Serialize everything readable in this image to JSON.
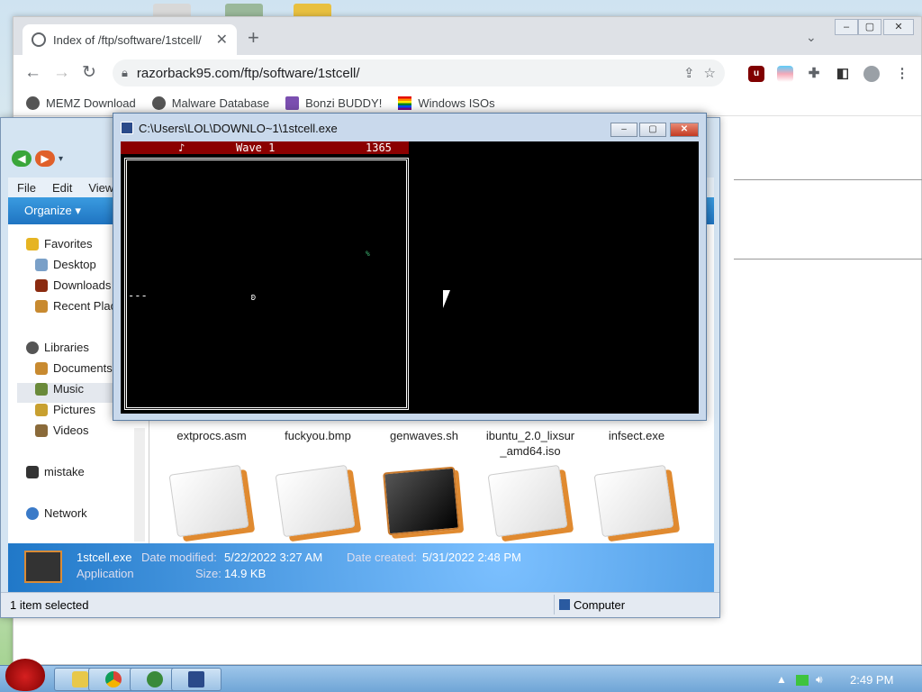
{
  "chrome": {
    "tab_title": "Index of /ftp/software/1stcell/",
    "url": "razorback95.com/ftp/software/1stcell/",
    "bookmarks": [
      "MEMZ Download",
      "Malware Database",
      "Bonzi BUDDY!",
      "Windows ISOs"
    ]
  },
  "explorer": {
    "menu": [
      "File",
      "Edit",
      "View"
    ],
    "organize": "Organize ▾",
    "nav": {
      "favorites": "Favorites",
      "desktop": "Desktop",
      "downloads": "Downloads",
      "recent": "Recent Plac",
      "libraries": "Libraries",
      "documents": "Documents",
      "music": "Music",
      "pictures": "Pictures",
      "videos": "Videos",
      "mistake": "mistake",
      "network": "Network"
    },
    "files": [
      "extprocs.asm",
      "fuckyou.bmp",
      "genwaves.sh",
      "ibuntu_2.0_lixsur _amd64.iso",
      "infsect.exe"
    ],
    "details": {
      "name": "1stcell.exe",
      "type": "Application",
      "modified_label": "Date modified:",
      "modified": "5/22/2022 3:27 AM",
      "created_label": "Date created:",
      "created": "5/31/2022 2:48 PM",
      "size_label": "Size:",
      "size": "14.9 KB"
    },
    "status_left": "1 item selected",
    "status_right": "Computer"
  },
  "console": {
    "title": "C:\\Users\\LOL\\DOWNLO~1\\1stcell.exe",
    "hud_note": "♪",
    "hud_wave": "Wave 1",
    "hud_score": "1365",
    "snake": "---",
    "player": "ʚ",
    "enemy": "%"
  },
  "taskbar": {
    "clock": "2:49 PM"
  }
}
